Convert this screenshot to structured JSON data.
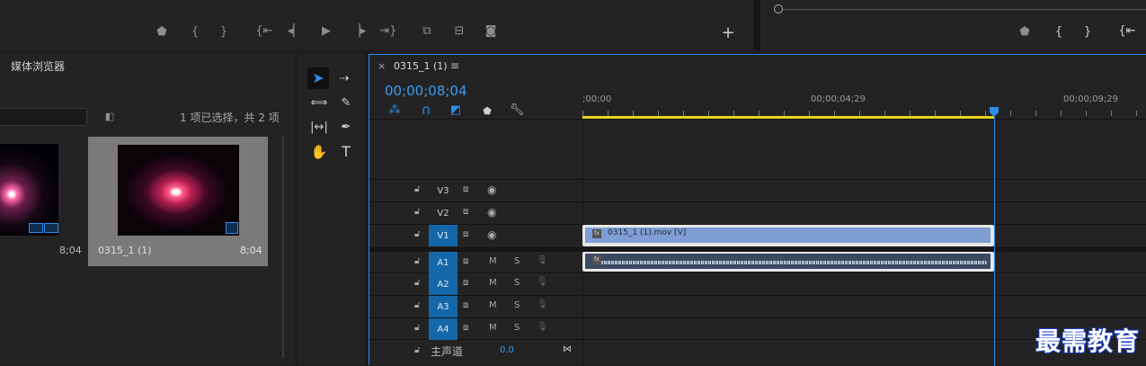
{
  "source_monitor": {
    "buttons": [
      "add-marker",
      "mark-in",
      "mark-out",
      "go-to-in",
      "step-back",
      "play",
      "step-forward",
      "go-to-out",
      "insert",
      "overwrite",
      "export-frame",
      "button-editor"
    ]
  },
  "program_monitor": {
    "buttons": [
      "add-marker",
      "mark-in",
      "mark-out",
      "go-to-in"
    ]
  },
  "media_browser": {
    "tab_label": "媒体浏览器",
    "selection_status": "1 项已选择，共 2 项",
    "clips": [
      {
        "name": "",
        "duration": "8;04"
      },
      {
        "name": "0315_1 (1)",
        "duration": "8;04"
      }
    ]
  },
  "tools": [
    "selection",
    "track-select-forward",
    "ripple-edit",
    "razor",
    "slip",
    "pen",
    "hand",
    "type"
  ],
  "timeline": {
    "tab_title": "0315_1 (1)",
    "close_glyph": "×",
    "menu_glyph": "≡",
    "timecode": "00;00;08;04",
    "ruler_labels": [
      ";00;00",
      "00;00;04;29",
      "00;00;09;29"
    ],
    "tracks": {
      "video": [
        {
          "name": "V3",
          "active": false
        },
        {
          "name": "V2",
          "active": false
        },
        {
          "name": "V1",
          "active": true
        }
      ],
      "audio": [
        {
          "name": "A1",
          "m": "M",
          "s": "S"
        },
        {
          "name": "A2",
          "m": "M",
          "s": "S"
        },
        {
          "name": "A3",
          "m": "M",
          "s": "S"
        },
        {
          "name": "A4",
          "m": "M",
          "s": "S"
        }
      ]
    },
    "master": {
      "label": "主声道",
      "value": "0.0"
    },
    "video_clip": {
      "label": "0315_1 (1).mov [V]",
      "fx": "fx"
    },
    "audio_clip": {
      "fx": "fx"
    }
  },
  "watermark": "最需教育",
  "colors": {
    "accent": "#2d8ceb",
    "work_area": "#e6d41e",
    "video_clip": "#7e9ed4",
    "audio_clip": "#3b4a63"
  }
}
